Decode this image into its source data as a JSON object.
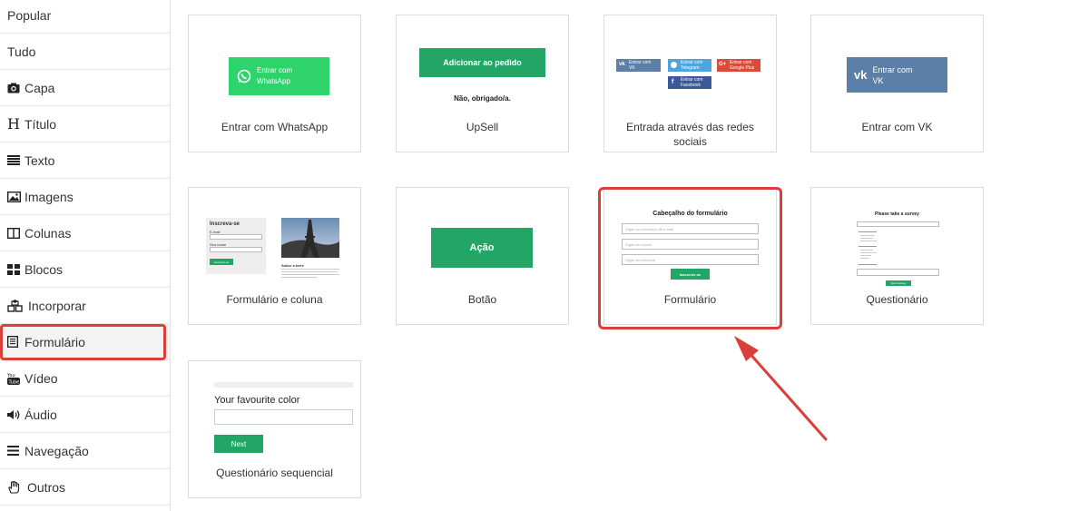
{
  "sidebar": {
    "items": [
      {
        "label": "Popular",
        "icon": ""
      },
      {
        "label": "Tudo",
        "icon": ""
      },
      {
        "label": "Capa",
        "icon": "camera-icon"
      },
      {
        "label": "Título",
        "icon": "heading-icon"
      },
      {
        "label": "Texto",
        "icon": "text-lines-icon"
      },
      {
        "label": "Imagens",
        "icon": "image-icon"
      },
      {
        "label": "Colunas",
        "icon": "columns-icon"
      },
      {
        "label": "Blocos",
        "icon": "blocks-icon"
      },
      {
        "label": "Incorporar",
        "icon": "cubes-icon"
      },
      {
        "label": "Formulário",
        "icon": "form-icon",
        "selected": true
      },
      {
        "label": "Vídeo",
        "icon": "youtube-icon"
      },
      {
        "label": "Áudio",
        "icon": "speaker-icon"
      },
      {
        "label": "Navegação",
        "icon": "menu-icon"
      },
      {
        "label": "Outros",
        "icon": "hand-icon"
      }
    ]
  },
  "cards": {
    "whatsapp": {
      "label": "Entrar com WhatsApp",
      "preview_btn": "Entrar com WhatsApp"
    },
    "upsell": {
      "label": "UpSell",
      "preview_btn": "Adicionar ao pedido",
      "preview_text": "Não, obrigado/a."
    },
    "social": {
      "label": "Entrada através das redes sociais",
      "btn_vk": "Entrar com VK",
      "btn_telegram": "Entrar com Telegram",
      "btn_google": "Entrar com Google Plus",
      "btn_facebook": "Entrar com Facebook"
    },
    "vk": {
      "label": "Entrar com VK",
      "preview_btn_line1": "Entrar com",
      "preview_btn_line2": "VK"
    },
    "form_column": {
      "label": "Formulário e coluna",
      "form_title": "Inscreva-se",
      "field1": "E-mail",
      "field2": "Seu nome",
      "btn": "Inscrever-se",
      "about_title": "Sobre a torre"
    },
    "button": {
      "label": "Botão",
      "preview_btn": "Ação"
    },
    "form": {
      "label": "Formulário",
      "preview_title": "Cabeçalho do formulário",
      "field1": "Digite seu endereço de e-mail",
      "field2": "Digite seu nome",
      "field3": "Digite seu telefone",
      "btn": "Inscrever-se"
    },
    "questionnaire": {
      "label": "Questionário",
      "preview_title": "Please take a survey",
      "btn": "Send survey"
    },
    "sequential": {
      "label": "Questionário sequencial",
      "question": "Your favourite color",
      "btn": "Next"
    }
  },
  "colors": {
    "highlight": "#d9403a",
    "green": "#23a665",
    "whatsapp": "#2ed36b",
    "vk": "#5b7fa6",
    "telegram": "#4ea5de",
    "google": "#dc4a38",
    "facebook": "#3b5998"
  }
}
